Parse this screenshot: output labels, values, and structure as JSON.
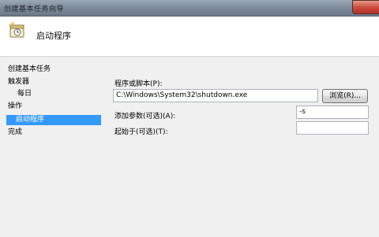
{
  "window": {
    "title": "创建基本任务向导"
  },
  "header": {
    "title": "启动程序",
    "icon": "task-wizard-icon"
  },
  "sidebar": {
    "items": [
      {
        "label": "创建基本任务"
      },
      {
        "label": "触发器"
      },
      {
        "label": "每日"
      },
      {
        "label": "操作"
      },
      {
        "label": "启动程序",
        "selected": true
      },
      {
        "label": "完成"
      }
    ]
  },
  "form": {
    "program_label": "程序或脚本(P):",
    "program_value": "C:\\Windows\\System32\\shutdown.exe",
    "browse_label": "浏览(R)...",
    "args_label": "添加参数(可选)(A):",
    "args_value": "-s",
    "startin_label": "起始于(可选)(T):",
    "startin_value": ""
  },
  "colors": {
    "selection": "#3399ff",
    "titlebar": "#7f8d9d"
  }
}
